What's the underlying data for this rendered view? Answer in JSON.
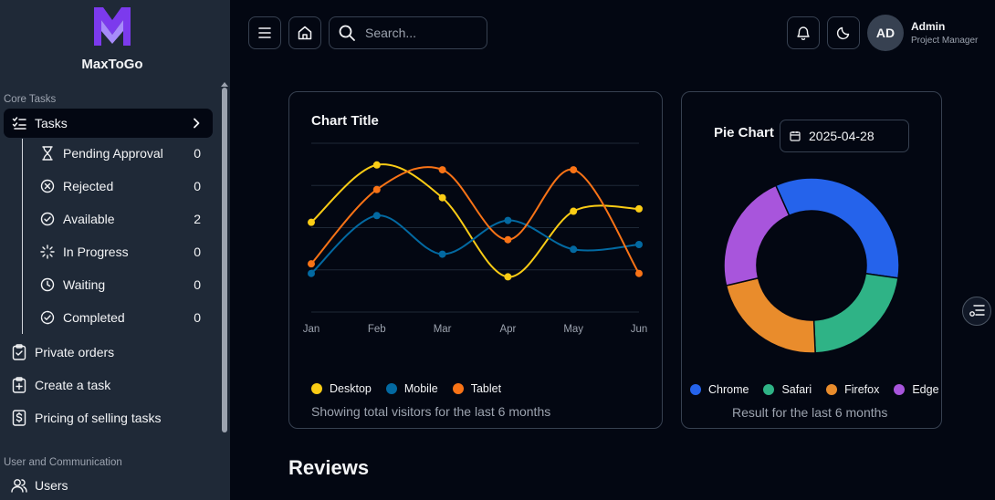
{
  "brand": {
    "name": "MaxToGo"
  },
  "sidebar": {
    "section_core": "Core Tasks",
    "tasks_label": "Tasks",
    "sub_items": [
      {
        "label": "Pending Approval",
        "count": "0",
        "icon": "hourglass-icon"
      },
      {
        "label": "Rejected",
        "count": "0",
        "icon": "circle-x-icon"
      },
      {
        "label": "Available",
        "count": "2",
        "icon": "circle-check-icon"
      },
      {
        "label": "In Progress",
        "count": "0",
        "icon": "loader-icon"
      },
      {
        "label": "Waiting",
        "count": "0",
        "icon": "clock-icon"
      },
      {
        "label": "Completed",
        "count": "0",
        "icon": "circle-check-icon"
      }
    ],
    "items": [
      {
        "label": "Private orders",
        "icon": "clipboard-check-icon"
      },
      {
        "label": "Create a task",
        "icon": "clipboard-plus-icon"
      },
      {
        "label": "Pricing of selling tasks",
        "icon": "dollar-file-icon"
      }
    ],
    "section_user": "User and Communication",
    "users_label": "Users"
  },
  "topbar": {
    "search_placeholder": "Search...",
    "avatar_initials": "AD",
    "user_name": "Admin",
    "user_role": "Project Manager"
  },
  "line_card": {
    "caption": "Showing total visitors for the last 6 months"
  },
  "pie_card": {
    "caption": "Result for the last 6 months",
    "date": "2025-04-28"
  },
  "reviews_title": "Reviews",
  "colors": {
    "desktop": "#facc15",
    "mobile": "#0369a1",
    "tablet": "#f97316",
    "chrome": "#2563eb",
    "safari": "#2fb386",
    "firefox": "#e98c2c",
    "edge": "#a855dc",
    "logo": "#8b5cf6"
  },
  "chart_data": [
    {
      "type": "line",
      "title": "Chart Title",
      "categories": [
        "Jan",
        "Feb",
        "Mar",
        "Apr",
        "May",
        "Jun"
      ],
      "ylim": [
        0,
        350
      ],
      "grid": true,
      "legend": "bottom-left",
      "series": [
        {
          "name": "Desktop",
          "values": [
            186,
            305,
            237,
            73,
            209,
            214
          ]
        },
        {
          "name": "Mobile",
          "values": [
            80,
            200,
            120,
            190,
            130,
            140
          ]
        },
        {
          "name": "Tablet",
          "values": [
            100,
            254,
            295,
            150,
            295,
            80
          ]
        }
      ]
    },
    {
      "type": "pie",
      "title": "Pie Chart",
      "legend": "bottom",
      "categories": [
        "Chrome",
        "Safari",
        "Firefox",
        "Edge"
      ],
      "values": [
        34,
        22,
        22,
        22
      ]
    }
  ]
}
